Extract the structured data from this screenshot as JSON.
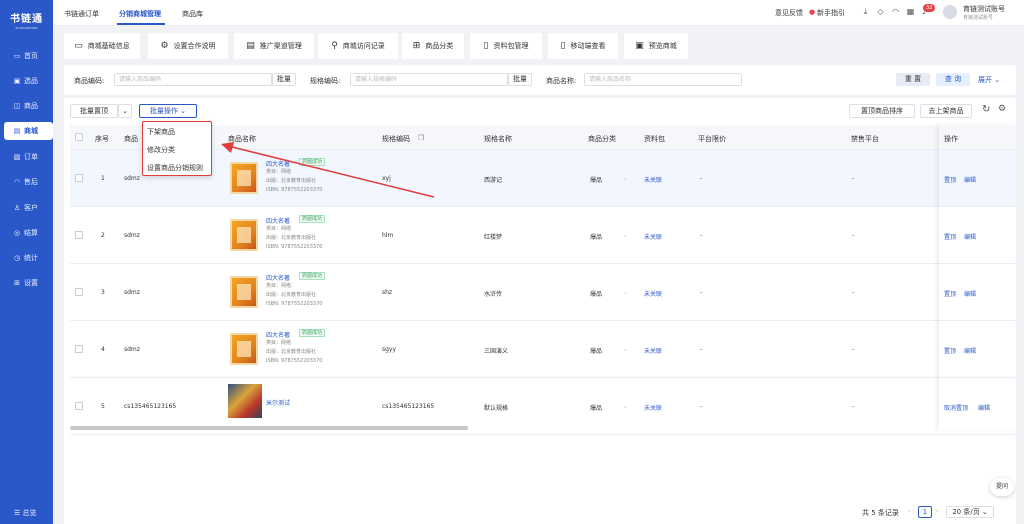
{
  "sidebar": {
    "logo": "书链通",
    "logo_sub": "SHULIANTONG",
    "items": [
      {
        "label": "首页",
        "icon": "monitor-icon"
      },
      {
        "label": "选品",
        "icon": "grid-icon"
      },
      {
        "label": "商品",
        "icon": "box-icon"
      },
      {
        "label": "商城",
        "icon": "store-icon"
      },
      {
        "label": "订单",
        "icon": "order-icon"
      },
      {
        "label": "售后",
        "icon": "headset-icon"
      },
      {
        "label": "客户",
        "icon": "users-icon"
      },
      {
        "label": "结算",
        "icon": "settle-icon"
      },
      {
        "label": "统计",
        "icon": "clock-icon"
      },
      {
        "label": "设置",
        "icon": "settings-icon"
      }
    ],
    "active": "商城",
    "footer": "总览"
  },
  "topbar": {
    "tabs": [
      "书链通订单",
      "分销商城管理",
      "商品库"
    ],
    "active_tab": "分销商城管理",
    "feedback": "意见反馈",
    "guide": "新手指引",
    "badge": "32",
    "user_name": "育链测试账号",
    "user_sub": "育链测试账号"
  },
  "toolbar": [
    {
      "label": "商城基础信息",
      "icon": "folder-icon"
    },
    {
      "label": "设置合作说明",
      "icon": "gear-icon"
    },
    {
      "label": "推广渠道管理",
      "icon": "doc-search-icon"
    },
    {
      "label": "商城访问记录",
      "icon": "user-search-icon"
    },
    {
      "label": "商品分类",
      "icon": "category-icon"
    },
    {
      "label": "资料包管理",
      "icon": "file-icon"
    },
    {
      "label": "移动端查看",
      "icon": "phone-icon"
    },
    {
      "label": "预览商城",
      "icon": "preview-icon"
    }
  ],
  "filter": {
    "code_label": "商品编码:",
    "code_placeholder": "请输入商品编码",
    "batch": "批量",
    "spec_label": "规格编码:",
    "spec_placeholder": "请输入规格编码",
    "name_label": "商品名称:",
    "name_placeholder": "请输入商品名称",
    "reset": "重 置",
    "query": "查 询",
    "expand": "展开"
  },
  "actions": {
    "batch_edit": "批量置顶",
    "batch_ops": "批量操作",
    "pin_sort": "置顶商品排序",
    "to_shelf": "去上架商品"
  },
  "dropdown": [
    "下架商品",
    "修改分类",
    "设置商品分销规则"
  ],
  "table": {
    "headers": {
      "index": "序号",
      "code": "商品",
      "name": "商品名称",
      "spec_code": "规格编码",
      "spec_name": "规格名称",
      "category": "商品分类",
      "pkg": "资料包",
      "limit": "平台限价",
      "banned": "禁售平台",
      "ops": "操作"
    },
    "rows": [
      {
        "index": "1",
        "code": "sdmz",
        "name": "四大名著",
        "tag": "抓图成功",
        "meta1": "类目：网络",
        "meta2": "出版：北京教育出版社",
        "meta3": "ISBN: 9787552203370",
        "spec_code": "xyj",
        "spec_name": "西游记",
        "category": "爆品",
        "pkg": "未关联",
        "limit": "-",
        "banned": "-",
        "op1": "置顶",
        "op2": "编辑"
      },
      {
        "index": "2",
        "code": "sdmz",
        "name": "四大名著",
        "tag": "抓图成功",
        "meta1": "类目：网络",
        "meta2": "出版：北京教育出版社",
        "meta3": "ISBN: 9787552203370",
        "spec_code": "hlm",
        "spec_name": "红楼梦",
        "category": "爆品",
        "pkg": "未关联",
        "limit": "-",
        "banned": "-",
        "op1": "置顶",
        "op2": "编辑"
      },
      {
        "index": "3",
        "code": "sdmz",
        "name": "四大名著",
        "tag": "抓图成功",
        "meta1": "类目：网络",
        "meta2": "出版：北京教育出版社",
        "meta3": "ISBN: 9787552203370",
        "spec_code": "shz",
        "spec_name": "水浒传",
        "category": "爆品",
        "pkg": "未关联",
        "limit": "-",
        "banned": "-",
        "op1": "置顶",
        "op2": "编辑"
      },
      {
        "index": "4",
        "code": "sdmz",
        "name": "四大名著",
        "tag": "抓图成功",
        "meta1": "类目：网络",
        "meta2": "出版：北京教育出版社",
        "meta3": "ISBN: 9787552203370",
        "spec_code": "sgyy",
        "spec_name": "三国演义",
        "category": "爆品",
        "pkg": "未关联",
        "limit": "-",
        "banned": "-",
        "op1": "置顶",
        "op2": "编辑"
      },
      {
        "index": "5",
        "code": "cs135465123165",
        "name": "米尔测试",
        "tag": "",
        "meta1": "",
        "meta2": "",
        "meta3": "",
        "spec_code": "cs135465123165",
        "spec_name": "默认规格",
        "category": "爆品",
        "pkg": "未关联",
        "limit": "-",
        "banned": "-",
        "op1": "取消置顶",
        "op2": "编辑"
      }
    ]
  },
  "pager": {
    "total": "共 5 条记录",
    "page": "1",
    "size": "20 条/页"
  },
  "help": "提问",
  "colors": {
    "primary": "#2b58c9",
    "success": "#3aa565",
    "danger": "#e23b3b"
  }
}
